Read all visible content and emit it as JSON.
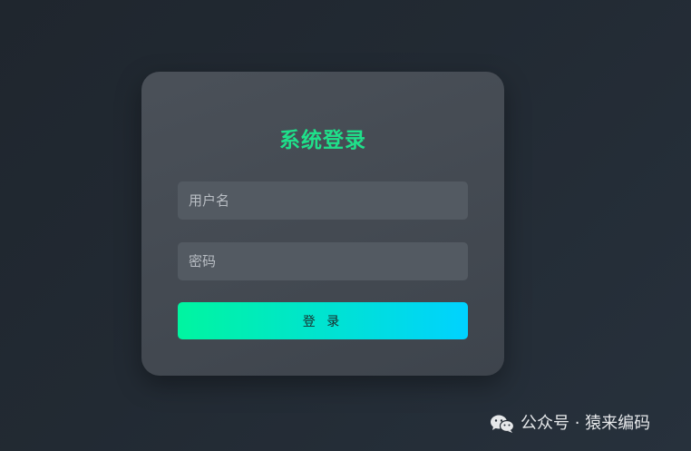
{
  "login": {
    "title": "系统登录",
    "username_placeholder": "用户名",
    "password_placeholder": "密码",
    "submit_label": "登 录"
  },
  "watermark": {
    "text": "公众号 · 猿来编码",
    "icon": "wechat-icon"
  },
  "colors": {
    "title": "#1fe08a",
    "button_gradient_start": "#00f5a0",
    "button_gradient_end": "#00d2ff",
    "card_background": "#4a5058",
    "page_background": "#222a33"
  }
}
